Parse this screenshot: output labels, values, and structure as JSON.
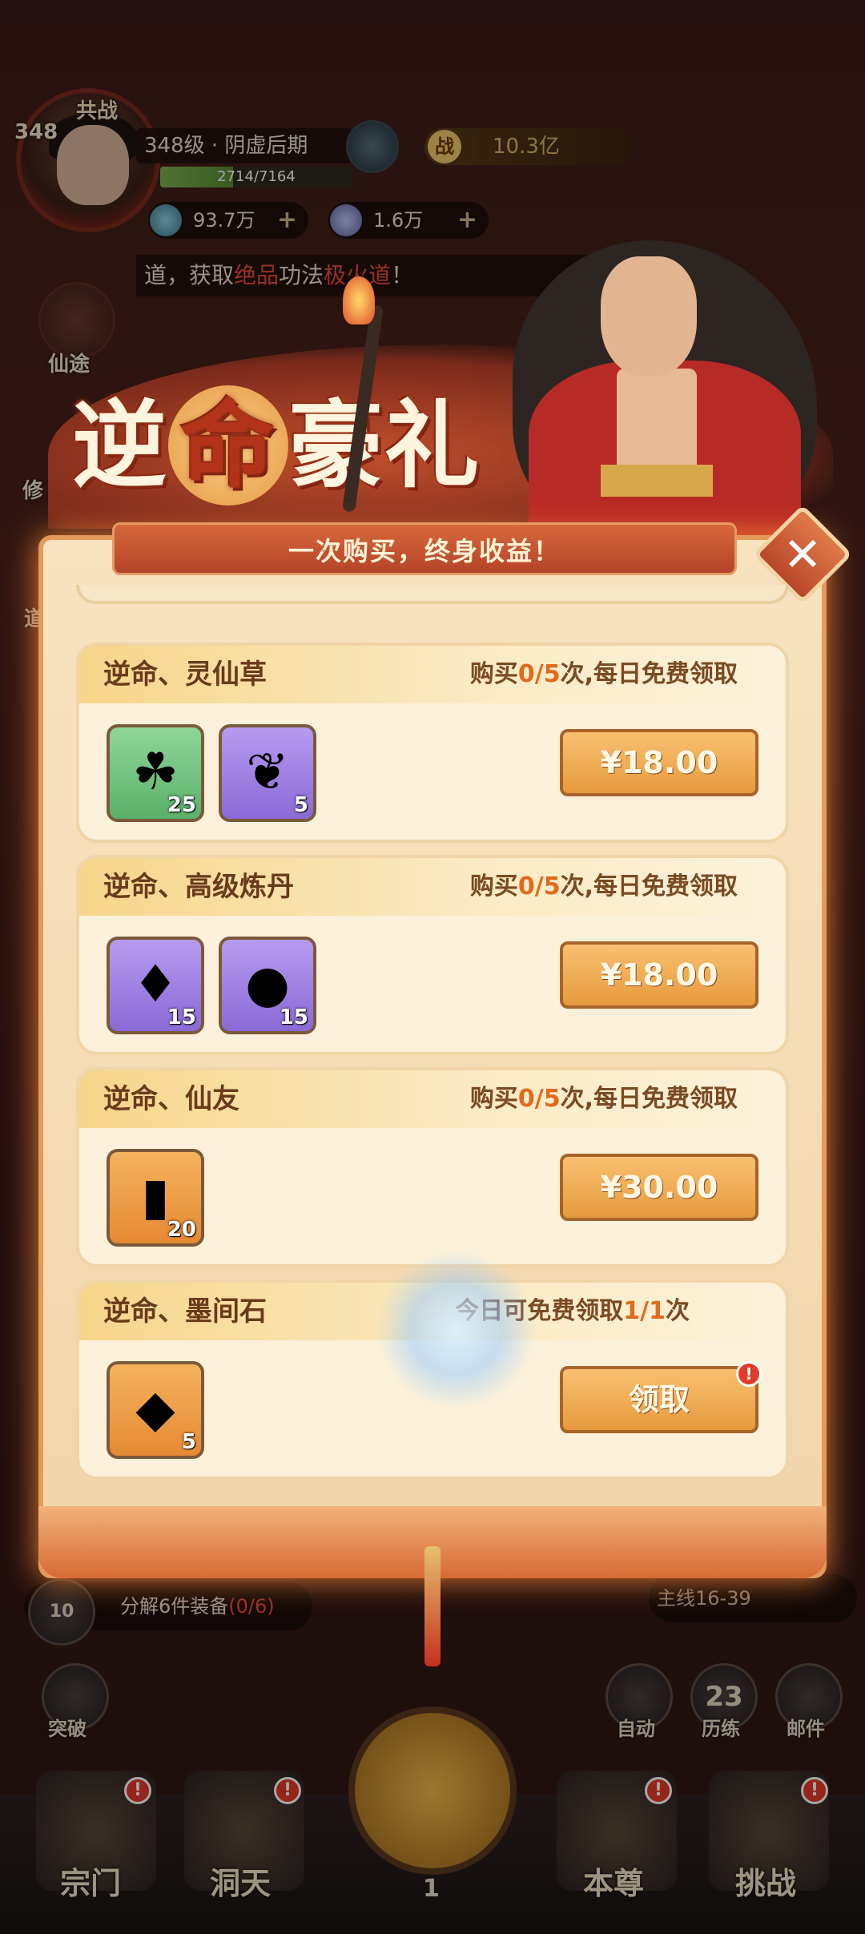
{
  "hud": {
    "level_badge": "348",
    "gongzhan": "共战",
    "level_text": "348级 · 阴虚后期",
    "exp_text": "2714/7164",
    "exp_fraction": 0.379,
    "power_icon": "战",
    "power_value": "10.3亿",
    "currency1": "93.7万",
    "currency2": "1.6万",
    "plus": "+",
    "ticker_prefix": "道，获取",
    "ticker_hl1": "绝品",
    "ticker_mid": "功法",
    "ticker_hl2": "极火道",
    "ticker_suffix": "！",
    "side_xiantu": "仙途",
    "side_xiu": "修",
    "side_dao": "道"
  },
  "title": {
    "part1": "逆",
    "part2": "命",
    "part3": "豪礼"
  },
  "modal": {
    "banner": "一次购买，终身收益！",
    "close": "✕"
  },
  "packs": [
    {
      "name": "逆命、灵仙草",
      "buy_prefix": "购买",
      "buy_count": "0/5",
      "buy_suffix": "次,每日免费领取",
      "items": [
        {
          "qty": "25",
          "icon": "herb-icon"
        },
        {
          "qty": "5",
          "icon": "feather-icon"
        }
      ],
      "price": "¥18.00"
    },
    {
      "name": "逆命、高级炼丹",
      "buy_prefix": "购买",
      "buy_count": "0/5",
      "buy_suffix": "次,每日免费领取",
      "items": [
        {
          "qty": "15",
          "icon": "flame-crystal-icon"
        },
        {
          "qty": "15",
          "icon": "pearl-icon"
        }
      ],
      "price": "¥18.00"
    },
    {
      "name": "逆命、仙友",
      "buy_prefix": "购买",
      "buy_count": "0/5",
      "buy_suffix": "次,每日免费领取",
      "items": [
        {
          "qty": "20",
          "icon": "token-icon"
        }
      ],
      "price": "¥30.00"
    },
    {
      "name": "逆命、墨间石",
      "buy_prefix": "今日可免费领取",
      "buy_count": "1/1",
      "buy_suffix": "次",
      "items": [
        {
          "qty": "5",
          "icon": "crystal-icon"
        }
      ],
      "price": "领取"
    }
  ],
  "lower": {
    "task_count": "10",
    "task_text": "分解6件装备",
    "task_progress": "(0/6)",
    "main_task": "主线16-39",
    "tupo": "突破",
    "auto": "自动",
    "lilian_count": "23",
    "lilian": "历练",
    "mail": "邮件"
  },
  "nav": {
    "zongmen": "宗门",
    "dongtian": "洞天",
    "benzun": "本尊",
    "tiaozhan": "挑战",
    "center_count": "1"
  },
  "colors": {
    "accent": "#e79a3e",
    "highlight": "#e06a1e",
    "red_dot": "#e53a2a"
  }
}
